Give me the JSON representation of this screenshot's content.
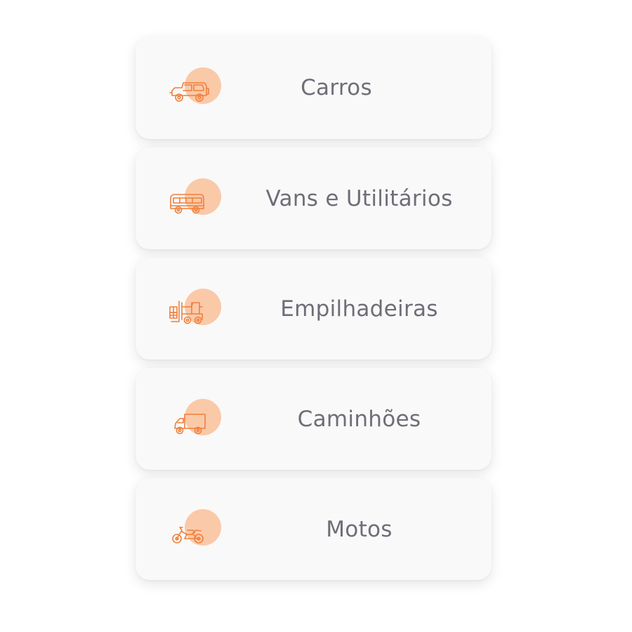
{
  "categories": [
    {
      "label": "Carros",
      "icon": "car-icon"
    },
    {
      "label": "Vans e Utilitários",
      "icon": "van-icon"
    },
    {
      "label": "Empilhadeiras",
      "icon": "forklift-icon"
    },
    {
      "label": "Caminhões",
      "icon": "truck-icon"
    },
    {
      "label": "Motos",
      "icon": "motorcycle-icon"
    }
  ],
  "colors": {
    "icon_stroke": "#f07f3c",
    "icon_blob": "#fac9a8",
    "card_bg": "#f9f9f9",
    "label_text": "#6e6e78"
  }
}
